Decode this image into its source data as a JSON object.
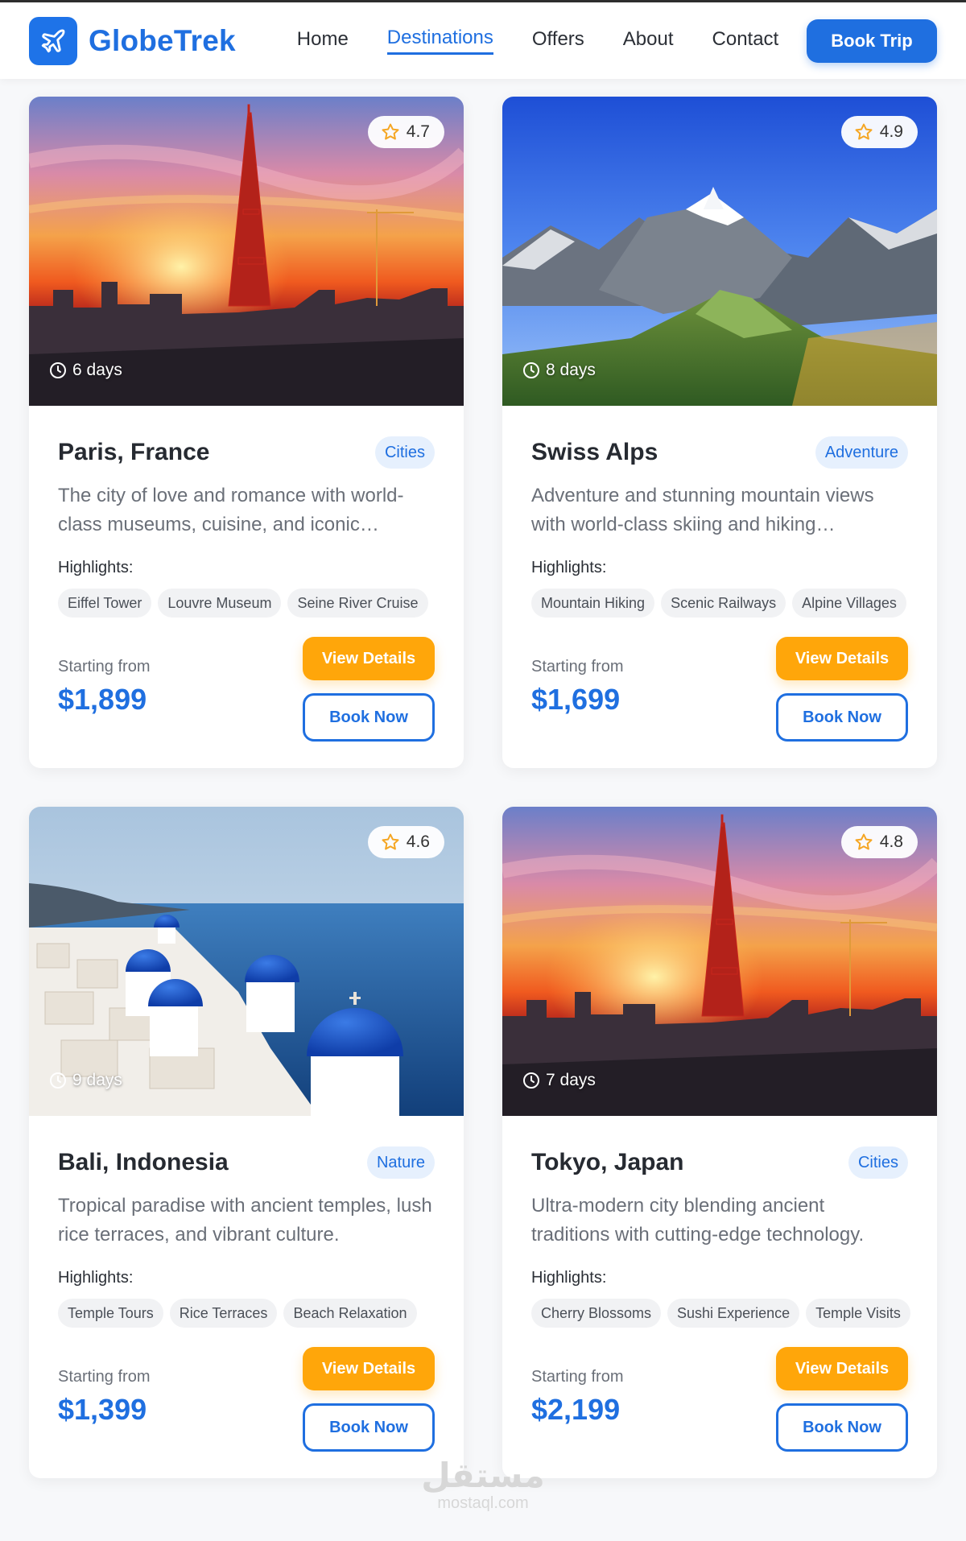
{
  "nav": {
    "brand": "GlobeTrek",
    "brand_icon": "airplane-icon",
    "links": [
      "Home",
      "Destinations",
      "Offers",
      "About",
      "Contact"
    ],
    "active_link": "Destinations",
    "cta": "Book Trip"
  },
  "colors": {
    "primary": "#1f6fe0",
    "accent": "#ffa60a",
    "chip_bg": "#f1f2f4",
    "category_bg": "#e6f0fd"
  },
  "labels": {
    "highlights": "Highlights:",
    "starting_from": "Starting from",
    "view_details": "View Details",
    "book_now": "Book Now"
  },
  "destinations": [
    {
      "name": "Paris, France",
      "category": "Cities",
      "rating": "4.7",
      "duration": "6 days",
      "description": "The city of love and romance with world-class museums, cuisine, and iconic…",
      "highlights": [
        "Eiffel Tower",
        "Louvre Museum",
        "Seine River Cruise"
      ],
      "price": "$1,899",
      "image": "eiffel-tower-sunset"
    },
    {
      "name": "Swiss Alps",
      "category": "Adventure",
      "rating": "4.9",
      "duration": "8 days",
      "description": "Adventure and stunning mountain views with world-class skiing and hiking…",
      "highlights": [
        "Mountain Hiking",
        "Scenic Railways",
        "Alpine Villages"
      ],
      "price": "$1,699",
      "image": "snowy-mountain-valley"
    },
    {
      "name": "Bali, Indonesia",
      "category": "Nature",
      "rating": "4.6",
      "duration": "9 days",
      "description": "Tropical paradise with ancient temples, lush rice terraces, and vibrant culture.",
      "highlights": [
        "Temple Tours",
        "Rice Terraces",
        "Beach Relaxation"
      ],
      "price": "$1,399",
      "image": "blue-dome-churches-sea"
    },
    {
      "name": "Tokyo, Japan",
      "category": "Cities",
      "rating": "4.8",
      "duration": "7 days",
      "description": "Ultra-modern city blending ancient traditions with cutting-edge technology.",
      "highlights": [
        "Cherry Blossoms",
        "Sushi Experience",
        "Temple Visits"
      ],
      "price": "$2,199",
      "image": "eiffel-tower-sunset"
    }
  ],
  "watermark": {
    "main": "مستقل",
    "sub": "mostaql.com"
  }
}
